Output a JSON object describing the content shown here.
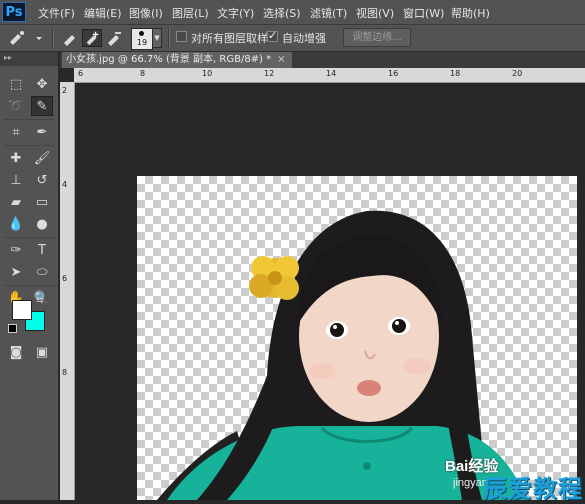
{
  "app": {
    "logo": "Ps"
  },
  "menu": [
    "文件(F)",
    "编辑(E)",
    "图像(I)",
    "图层(L)",
    "文字(Y)",
    "选择(S)",
    "滤镜(T)",
    "视图(V)",
    "窗口(W)",
    "帮助(H)"
  ],
  "options": {
    "brush_size": "19",
    "sample_all_layers": "对所有图层取样",
    "sample_all_layers_checked": false,
    "auto_enhance": "自动增强",
    "auto_enhance_checked": true,
    "refine_edge": "调整边缘..."
  },
  "document": {
    "tab_title": "小女孩.jpg @ 66.7% (背景 副本, RGB/8#) *",
    "close_glyph": "×"
  },
  "ruler": {
    "top_labels": [
      "6",
      "8",
      "10",
      "12",
      "14",
      "16",
      "18",
      "20"
    ],
    "left_labels": [
      "2",
      "4",
      "6",
      "8"
    ]
  },
  "toolbar": {
    "tools": [
      "marquee-icon",
      "move-icon",
      "lasso-icon",
      "quick-selection-icon",
      "crop-icon",
      "eyedropper-icon",
      "healing-brush-icon",
      "brush-icon",
      "clone-stamp-icon",
      "history-brush-icon",
      "eraser-icon",
      "gradient-icon",
      "blur-icon",
      "dodge-icon",
      "pen-icon",
      "type-icon",
      "path-selection-icon",
      "shape-icon",
      "hand-icon",
      "zoom-icon"
    ],
    "foreground_color": "#ffffff",
    "background_color": "#00ffe9"
  },
  "watermark": {
    "brand": "Bai",
    "brand2": "经验",
    "domain": "jingyan",
    "site_cn": "辰爱教程"
  }
}
